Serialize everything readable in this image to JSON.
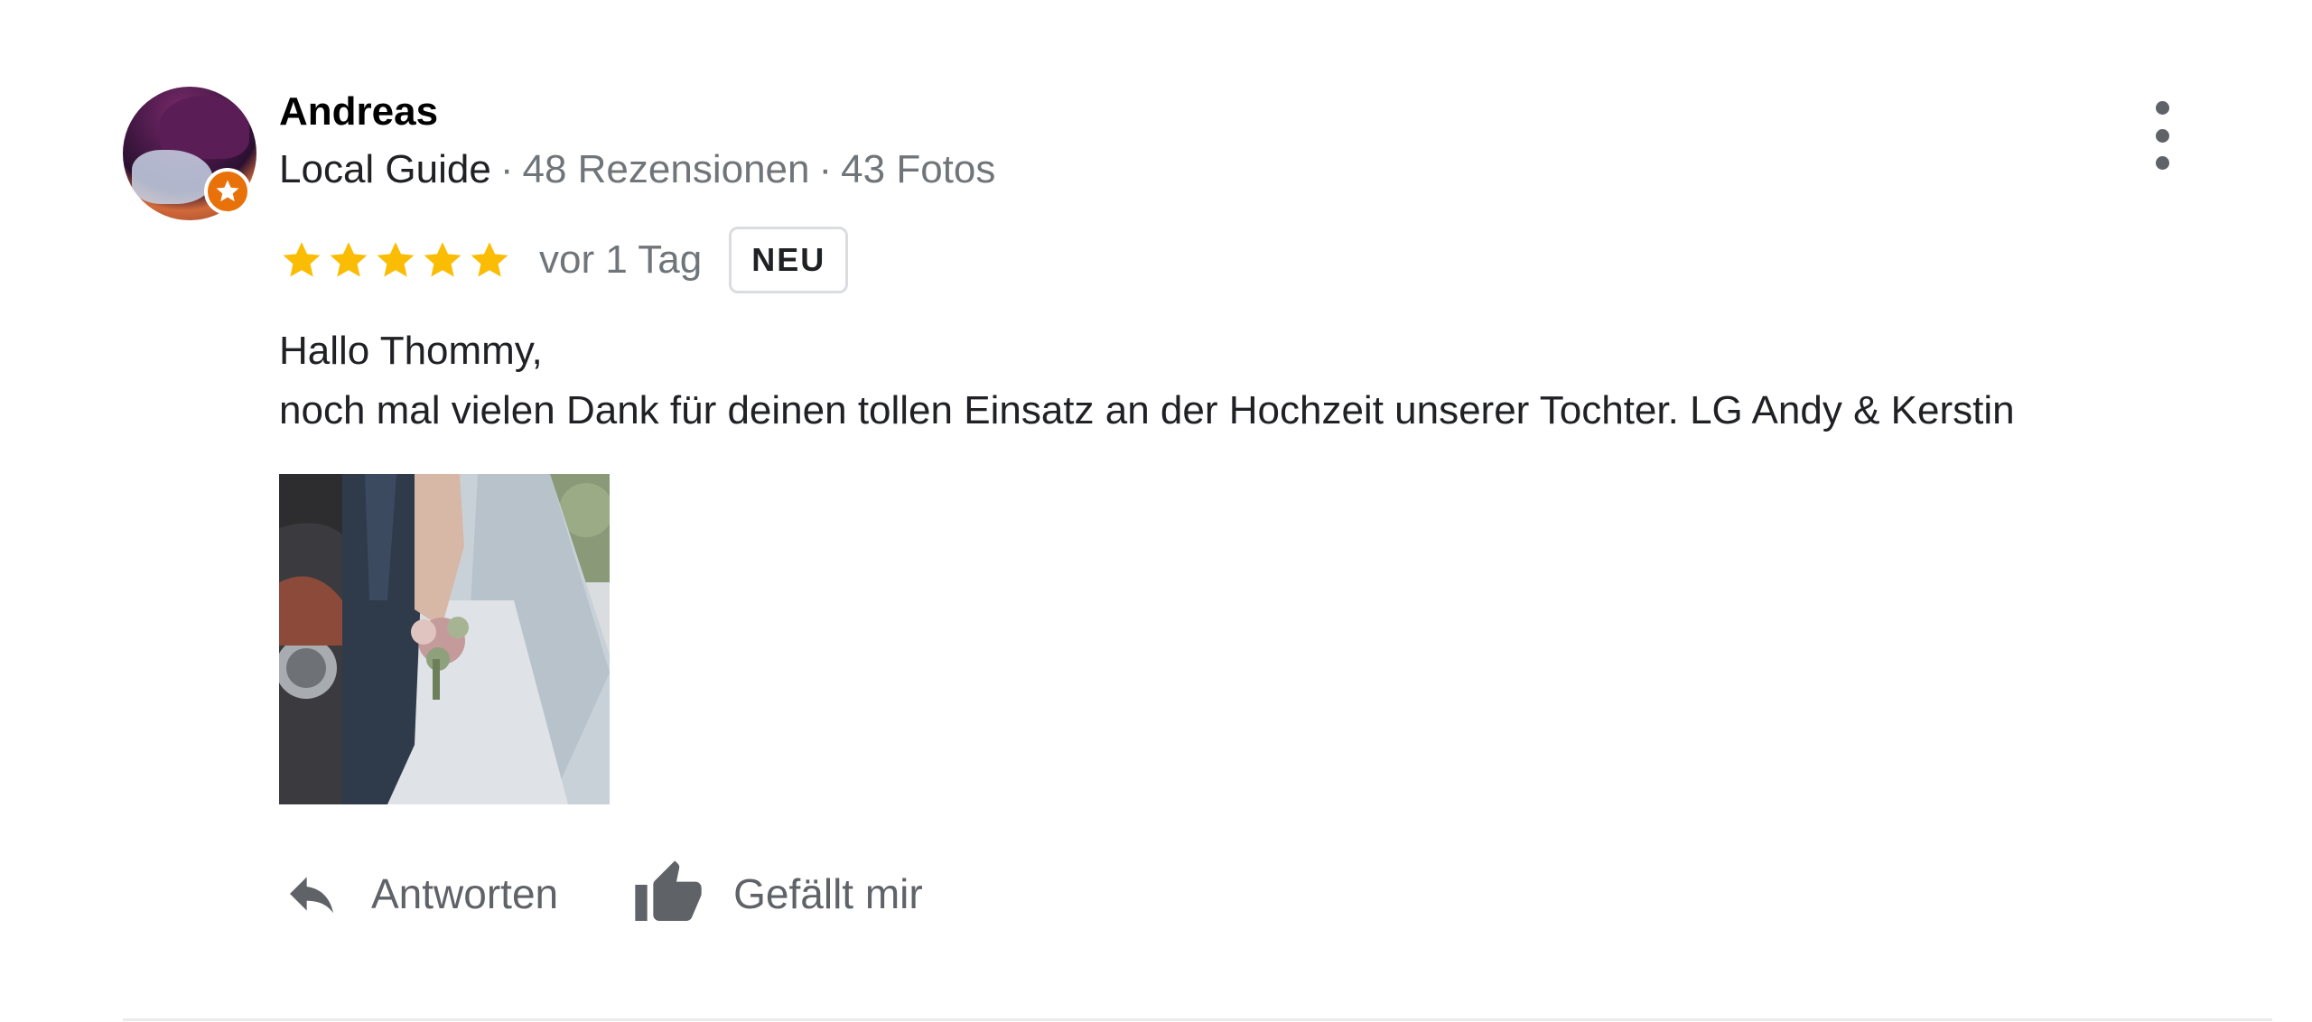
{
  "review": {
    "author_name": "Andreas",
    "author_level": "Local Guide",
    "review_count": "48 Rezensionen",
    "photo_count": "43 Fotos",
    "separator": "·",
    "rating": 5,
    "time_ago": "vor 1 Tag",
    "new_badge": "NEU",
    "text_line1": "Hallo Thommy,",
    "text_line2": "noch mal vielen Dank für deinen tollen Einsatz an der Hochzeit unserer Tochter. LG Andy & Kerstin"
  },
  "actions": {
    "reply_label": "Antworten",
    "like_label": "Gefällt mir"
  },
  "icons": {
    "more": "more-vert-icon",
    "reply": "reply-icon",
    "like": "thumb-up-icon",
    "star": "star-icon",
    "guide_badge": "local-guide-star-icon"
  },
  "colors": {
    "star": "#fbbc04",
    "guide_badge": "#e8710a",
    "secondary_text": "#70757a",
    "icon": "#5f6368"
  }
}
